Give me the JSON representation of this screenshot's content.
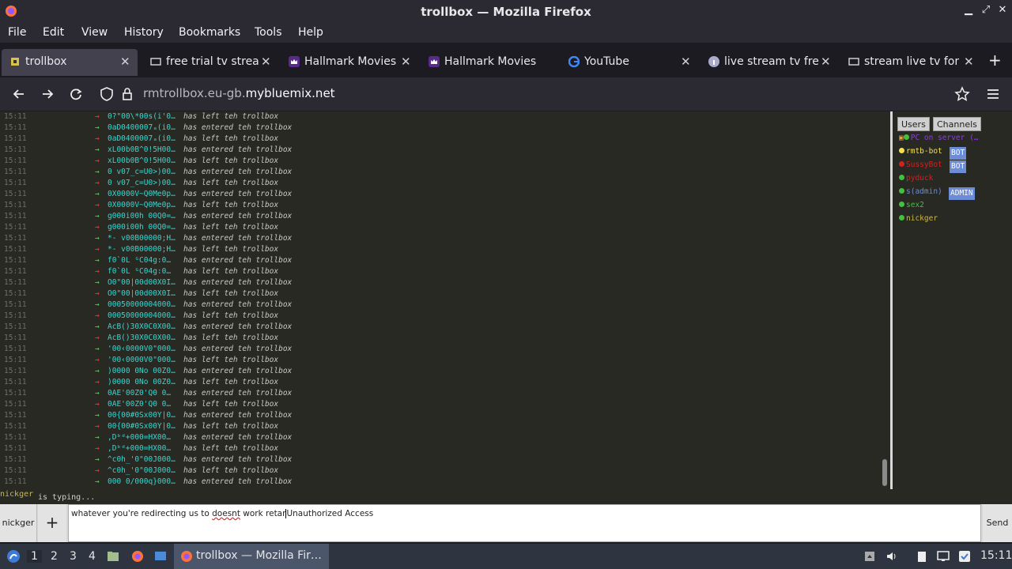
{
  "window": {
    "title": "trollbox — Mozilla Firefox"
  },
  "menu": [
    "File",
    "Edit",
    "View",
    "History",
    "Bookmarks",
    "Tools",
    "Help"
  ],
  "tabs": [
    {
      "label": "trollbox",
      "active": true,
      "icon": "trollbox-favicon"
    },
    {
      "label": "free trial tv strea",
      "icon": "page-icon"
    },
    {
      "label": "Hallmark Movies N",
      "icon": "hallmark-crown-icon"
    },
    {
      "label": "Hallmark Movies N",
      "icon": "hallmark-crown-icon"
    },
    {
      "label": "YouTube",
      "icon": "google-g-icon"
    },
    {
      "label": "live stream tv free",
      "icon": "info-icon"
    },
    {
      "label": "stream live tv for",
      "icon": "page-icon"
    }
  ],
  "urlbar": {
    "prefix": "rmtrollbox.eu-gb.",
    "domain": "mybluemix.net"
  },
  "log": [
    {
      "time": "15:11",
      "dir": "out",
      "nick": "0?\"00\\*00s(i'0…",
      "msg": "has left teh trollbox"
    },
    {
      "time": "15:11",
      "dir": "in",
      "nick": "0aD0400007ₐ(i0…",
      "msg": "has entered teh trollbox"
    },
    {
      "time": "15:11",
      "dir": "out",
      "nick": "0aD0400007ₐ(i0…",
      "msg": "has left teh trollbox"
    },
    {
      "time": "15:11",
      "dir": "in",
      "nick": "xL00b0B^0!5H00…",
      "msg": "has entered teh trollbox"
    },
    {
      "time": "15:11",
      "dir": "out",
      "nick": "xL00b0B^0!5H00…",
      "msg": "has left teh trollbox"
    },
    {
      "time": "15:11",
      "dir": "in",
      "nick": "0 v07_c=U0>)00…",
      "msg": "has entered teh trollbox"
    },
    {
      "time": "15:11",
      "dir": "out",
      "nick": "0 v07_c=U0>)00…",
      "msg": "has left teh trollbox"
    },
    {
      "time": "15:11",
      "dir": "in",
      "nick": "0X0000V~Q0Me0p…",
      "msg": "has entered teh trollbox"
    },
    {
      "time": "15:11",
      "dir": "out",
      "nick": "0X0000V~Q0Me0p…",
      "msg": "has left teh trollbox"
    },
    {
      "time": "15:11",
      "dir": "in",
      "nick": "g000i00h 00Q0=…",
      "msg": "has entered teh trollbox"
    },
    {
      "time": "15:11",
      "dir": "out",
      "nick": "g000i00h 00Q0=…",
      "msg": "has left teh trollbox"
    },
    {
      "time": "15:11",
      "dir": "in",
      "nick": "*- v00B00000;H…",
      "msg": "has entered teh trollbox"
    },
    {
      "time": "15:11",
      "dir": "out",
      "nick": "*- v00B00000;H…",
      "msg": "has left teh trollbox"
    },
    {
      "time": "15:11",
      "dir": "in",
      "nick": "f0`0L ᴳC04g:0…",
      "msg": "has entered teh trollbox"
    },
    {
      "time": "15:11",
      "dir": "out",
      "nick": "f0`0L ᴳC04g:0…",
      "msg": "has left teh trollbox"
    },
    {
      "time": "15:11",
      "dir": "in",
      "nick": "O0\"00|00d00X0I…",
      "msg": "has entered teh trollbox"
    },
    {
      "time": "15:11",
      "dir": "out",
      "nick": "O0\"00|00d00X0I…",
      "msg": "has left teh trollbox"
    },
    {
      "time": "15:11",
      "dir": "in",
      "nick": "00050000004000…",
      "msg": "has entered teh trollbox"
    },
    {
      "time": "15:11",
      "dir": "out",
      "nick": "00050000004000…",
      "msg": "has left teh trollbox"
    },
    {
      "time": "15:11",
      "dir": "in",
      "nick": "AcB()30X0C0X00…",
      "msg": "has entered teh trollbox"
    },
    {
      "time": "15:11",
      "dir": "out",
      "nick": "AcB()30X0C0X00…",
      "msg": "has left teh trollbox"
    },
    {
      "time": "15:11",
      "dir": "in",
      "nick": "'00‹0000V0\"000…",
      "msg": "has entered teh trollbox"
    },
    {
      "time": "15:11",
      "dir": "out",
      "nick": "'00‹0000V0\"000…",
      "msg": "has left teh trollbox"
    },
    {
      "time": "15:11",
      "dir": "in",
      "nick": ")0000 0No 00Z0…",
      "msg": "has entered teh trollbox"
    },
    {
      "time": "15:11",
      "dir": "out",
      "nick": ")0000 0No 00Z0…",
      "msg": "has left teh trollbox"
    },
    {
      "time": "15:11",
      "dir": "in",
      "nick": "0AE'00Z0'Q0 0…",
      "msg": "has entered teh trollbox"
    },
    {
      "time": "15:11",
      "dir": "out",
      "nick": "0AE'00Z0'Q0 0…",
      "msg": "has left teh trollbox"
    },
    {
      "time": "15:11",
      "dir": "in",
      "nick": "00{00#0Sx00Y|0…",
      "msg": "has entered teh trollbox"
    },
    {
      "time": "15:11",
      "dir": "out",
      "nick": "00{00#0Sx00Y|0…",
      "msg": "has left teh trollbox"
    },
    {
      "time": "15:11",
      "dir": "in",
      "nick": ",Dᵇᵈ+000=HX00…",
      "msg": "has entered teh trollbox"
    },
    {
      "time": "15:11",
      "dir": "out",
      "nick": ",Dᵇᵈ+000=HX00…",
      "msg": "has left teh trollbox"
    },
    {
      "time": "15:11",
      "dir": "in",
      "nick": "^c0h_'0\"00J000…",
      "msg": "has entered teh trollbox"
    },
    {
      "time": "15:11",
      "dir": "out",
      "nick": "^c0h_'0\"00J000…",
      "msg": "has left teh trollbox"
    },
    {
      "time": "15:11",
      "dir": "in",
      "nick": "000 0/000q}000…",
      "msg": "has entered teh trollbox"
    }
  ],
  "sidebar": {
    "tabs": [
      "Users",
      "Channels"
    ],
    "users": [
      {
        "name": "PC on server (…",
        "color": "#8b3fd6",
        "dot": "#41c23c",
        "lock": true
      },
      {
        "name": "rmtb-bot",
        "color": "#f5e14a",
        "dot": "#f5e14a",
        "badge": "BOT"
      },
      {
        "name": "SussyBot",
        "color": "#d62020",
        "dot": "#d62020",
        "badge": "BOT"
      },
      {
        "name": "pyduck",
        "color": "#d62020",
        "dot": "#41c23c"
      },
      {
        "name": "s(admin)",
        "color": "#6c8cd8",
        "dot": "#41c23c",
        "badge": "ADMIN"
      },
      {
        "name": "sex2",
        "color": "#41c23c",
        "dot": "#41c23c"
      },
      {
        "name": "nickger",
        "color": "#c9b84a",
        "dot": "#41c23c"
      }
    ]
  },
  "typing": {
    "nick": "nickger",
    "text": "is typing..."
  },
  "input": {
    "nick_button": "nickger",
    "plus": "+",
    "text_before": "whatever you're redirecting us to ",
    "misspelled": "doesnt",
    "text_after": " work retar",
    "text_tail": "Unauthorized Access",
    "send": "Send"
  },
  "taskbar": {
    "workspaces": [
      "1",
      "2",
      "3",
      "4"
    ],
    "task_label": "trollbox — Mozilla Fir…",
    "clock": "15:11"
  }
}
